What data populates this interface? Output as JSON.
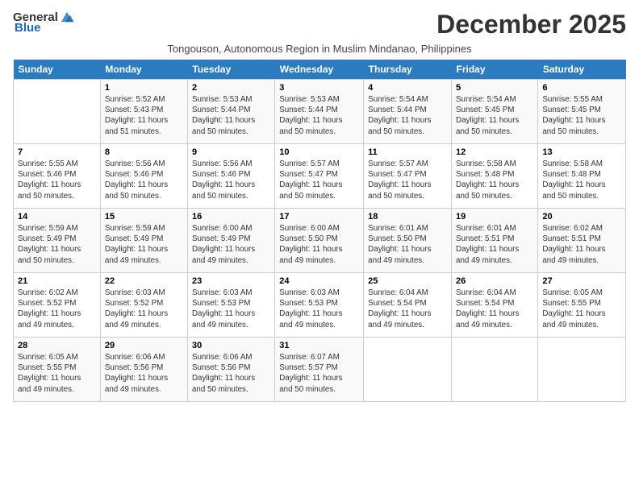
{
  "header": {
    "logo_general": "General",
    "logo_blue": "Blue",
    "month_title": "December 2025",
    "subtitle": "Tongouson, Autonomous Region in Muslim Mindanao, Philippines"
  },
  "weekdays": [
    "Sunday",
    "Monday",
    "Tuesday",
    "Wednesday",
    "Thursday",
    "Friday",
    "Saturday"
  ],
  "weeks": [
    [
      {
        "day": "",
        "info": ""
      },
      {
        "day": "1",
        "info": "Sunrise: 5:52 AM\nSunset: 5:43 PM\nDaylight: 11 hours\nand 51 minutes."
      },
      {
        "day": "2",
        "info": "Sunrise: 5:53 AM\nSunset: 5:44 PM\nDaylight: 11 hours\nand 50 minutes."
      },
      {
        "day": "3",
        "info": "Sunrise: 5:53 AM\nSunset: 5:44 PM\nDaylight: 11 hours\nand 50 minutes."
      },
      {
        "day": "4",
        "info": "Sunrise: 5:54 AM\nSunset: 5:44 PM\nDaylight: 11 hours\nand 50 minutes."
      },
      {
        "day": "5",
        "info": "Sunrise: 5:54 AM\nSunset: 5:45 PM\nDaylight: 11 hours\nand 50 minutes."
      },
      {
        "day": "6",
        "info": "Sunrise: 5:55 AM\nSunset: 5:45 PM\nDaylight: 11 hours\nand 50 minutes."
      }
    ],
    [
      {
        "day": "7",
        "info": "Sunrise: 5:55 AM\nSunset: 5:46 PM\nDaylight: 11 hours\nand 50 minutes."
      },
      {
        "day": "8",
        "info": "Sunrise: 5:56 AM\nSunset: 5:46 PM\nDaylight: 11 hours\nand 50 minutes."
      },
      {
        "day": "9",
        "info": "Sunrise: 5:56 AM\nSunset: 5:46 PM\nDaylight: 11 hours\nand 50 minutes."
      },
      {
        "day": "10",
        "info": "Sunrise: 5:57 AM\nSunset: 5:47 PM\nDaylight: 11 hours\nand 50 minutes."
      },
      {
        "day": "11",
        "info": "Sunrise: 5:57 AM\nSunset: 5:47 PM\nDaylight: 11 hours\nand 50 minutes."
      },
      {
        "day": "12",
        "info": "Sunrise: 5:58 AM\nSunset: 5:48 PM\nDaylight: 11 hours\nand 50 minutes."
      },
      {
        "day": "13",
        "info": "Sunrise: 5:58 AM\nSunset: 5:48 PM\nDaylight: 11 hours\nand 50 minutes."
      }
    ],
    [
      {
        "day": "14",
        "info": "Sunrise: 5:59 AM\nSunset: 5:49 PM\nDaylight: 11 hours\nand 50 minutes."
      },
      {
        "day": "15",
        "info": "Sunrise: 5:59 AM\nSunset: 5:49 PM\nDaylight: 11 hours\nand 49 minutes."
      },
      {
        "day": "16",
        "info": "Sunrise: 6:00 AM\nSunset: 5:49 PM\nDaylight: 11 hours\nand 49 minutes."
      },
      {
        "day": "17",
        "info": "Sunrise: 6:00 AM\nSunset: 5:50 PM\nDaylight: 11 hours\nand 49 minutes."
      },
      {
        "day": "18",
        "info": "Sunrise: 6:01 AM\nSunset: 5:50 PM\nDaylight: 11 hours\nand 49 minutes."
      },
      {
        "day": "19",
        "info": "Sunrise: 6:01 AM\nSunset: 5:51 PM\nDaylight: 11 hours\nand 49 minutes."
      },
      {
        "day": "20",
        "info": "Sunrise: 6:02 AM\nSunset: 5:51 PM\nDaylight: 11 hours\nand 49 minutes."
      }
    ],
    [
      {
        "day": "21",
        "info": "Sunrise: 6:02 AM\nSunset: 5:52 PM\nDaylight: 11 hours\nand 49 minutes."
      },
      {
        "day": "22",
        "info": "Sunrise: 6:03 AM\nSunset: 5:52 PM\nDaylight: 11 hours\nand 49 minutes."
      },
      {
        "day": "23",
        "info": "Sunrise: 6:03 AM\nSunset: 5:53 PM\nDaylight: 11 hours\nand 49 minutes."
      },
      {
        "day": "24",
        "info": "Sunrise: 6:03 AM\nSunset: 5:53 PM\nDaylight: 11 hours\nand 49 minutes."
      },
      {
        "day": "25",
        "info": "Sunrise: 6:04 AM\nSunset: 5:54 PM\nDaylight: 11 hours\nand 49 minutes."
      },
      {
        "day": "26",
        "info": "Sunrise: 6:04 AM\nSunset: 5:54 PM\nDaylight: 11 hours\nand 49 minutes."
      },
      {
        "day": "27",
        "info": "Sunrise: 6:05 AM\nSunset: 5:55 PM\nDaylight: 11 hours\nand 49 minutes."
      }
    ],
    [
      {
        "day": "28",
        "info": "Sunrise: 6:05 AM\nSunset: 5:55 PM\nDaylight: 11 hours\nand 49 minutes."
      },
      {
        "day": "29",
        "info": "Sunrise: 6:06 AM\nSunset: 5:56 PM\nDaylight: 11 hours\nand 49 minutes."
      },
      {
        "day": "30",
        "info": "Sunrise: 6:06 AM\nSunset: 5:56 PM\nDaylight: 11 hours\nand 50 minutes."
      },
      {
        "day": "31",
        "info": "Sunrise: 6:07 AM\nSunset: 5:57 PM\nDaylight: 11 hours\nand 50 minutes."
      },
      {
        "day": "",
        "info": ""
      },
      {
        "day": "",
        "info": ""
      },
      {
        "day": "",
        "info": ""
      }
    ]
  ]
}
